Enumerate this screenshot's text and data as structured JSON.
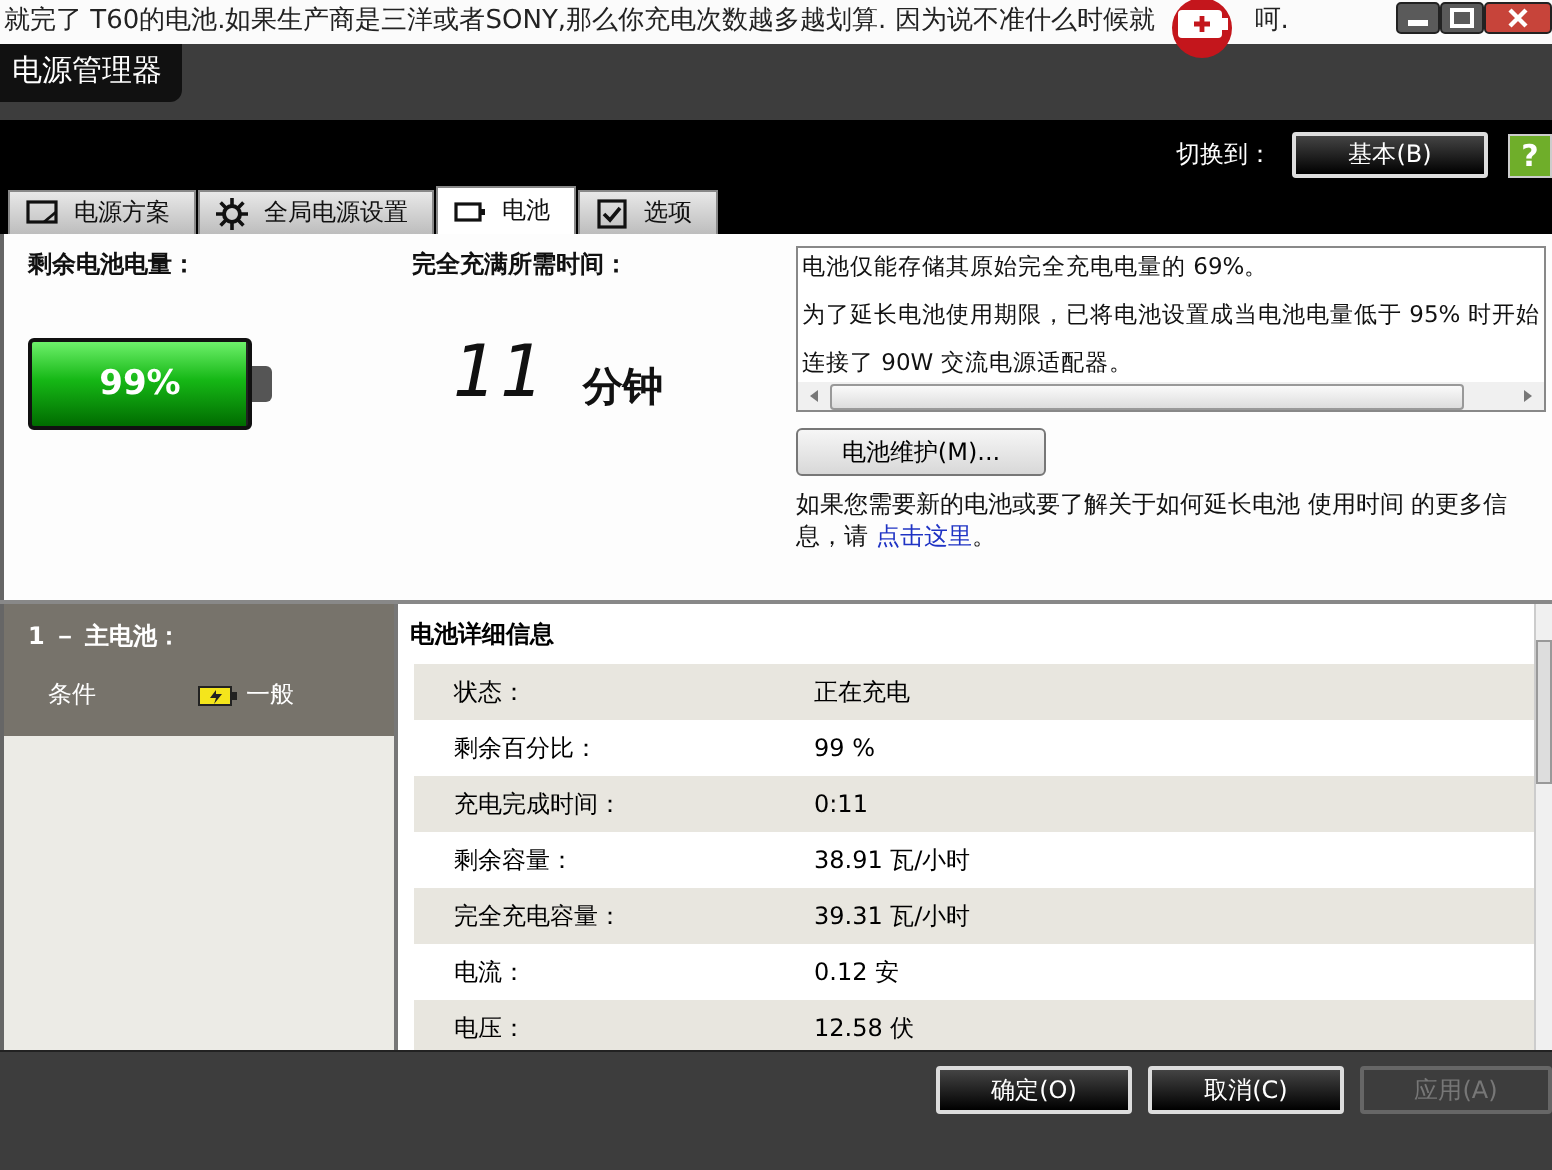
{
  "background_text": [
    "就完了 T60的电池.如果生产商是三洋或者SONY,那么你充电次数越多越划算. 因为说不准什么时候就",
    "呵."
  ],
  "window": {
    "title": "电源管理器"
  },
  "switch_to": {
    "label": "切换到：",
    "button": "基本(B)",
    "help": "?"
  },
  "tabs": [
    {
      "kind": "plan",
      "label": "电源方案",
      "selected": false
    },
    {
      "kind": "gear",
      "label": "全局电源设置",
      "selected": false
    },
    {
      "kind": "battery",
      "label": "电池",
      "selected": true
    },
    {
      "kind": "check",
      "label": "选项",
      "selected": false
    }
  ],
  "battery_panel": {
    "remaining_label": "剩余电池电量：",
    "level": 0.99,
    "percent": "99%",
    "time_label": "完全充满所需时间：",
    "time_value": "11",
    "time_unit": "分钟"
  },
  "messages": [
    "电池仅能存储其原始完全充电电量的 69%。",
    "为了延长电池使用期限，已将电池设置成当电池电量低于 95% 时开始",
    "连接了 90W 交流电源适配器。"
  ],
  "maintenance_button": "电池维护(M)...",
  "info": {
    "text": "如果您需要新的电池或要了解关于如何延长电池 使用时间 的更多信息，请 ",
    "link": "点击这里",
    "end": "。"
  },
  "sidebar": {
    "battery_title": "1 － 主电池：",
    "condition_label": "条件",
    "condition_value": "一般"
  },
  "details": {
    "title": "电池详细信息",
    "rows": [
      {
        "label": "状态：",
        "value": "正在充电"
      },
      {
        "label": "剩余百分比：",
        "value": "99 %"
      },
      {
        "label": "充电完成时间：",
        "value": "0:11"
      },
      {
        "label": "剩余容量：",
        "value": "38.91 瓦/小时"
      },
      {
        "label": "完全充电容量：",
        "value": "39.31 瓦/小时"
      },
      {
        "label": "电流：",
        "value": "0.12 安"
      },
      {
        "label": "电压：",
        "value": "12.58 伏"
      }
    ]
  },
  "buttons": [
    {
      "label": "确定(O)",
      "disabled": false
    },
    {
      "label": "取消(C)",
      "disabled": false
    },
    {
      "label": "应用(A)",
      "disabled": true
    }
  ]
}
